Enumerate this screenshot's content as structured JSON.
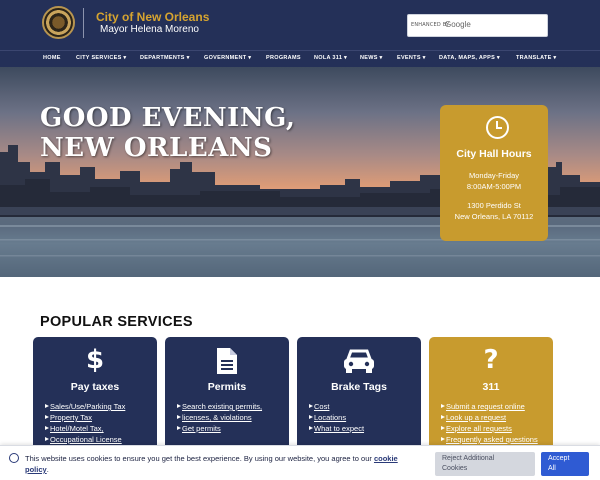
{
  "header": {
    "city_name": "City of New Orleans",
    "mayor_name": "Mayor Helena Moreno",
    "search": {
      "enhanced_label": "ENHANCED BY",
      "provider": "Google"
    }
  },
  "nav": {
    "items": [
      "HOME",
      "CITY SERVICES ▾",
      "DEPARTMENTS ▾",
      "GOVERNMENT ▾",
      "PROGRAMS",
      "NOLA 311 ▾",
      "NEWS ▾",
      "EVENTS ▾",
      "DATA, MAPS, APPS ▾",
      "TRANSLATE ▾"
    ]
  },
  "hero": {
    "greeting_line1": "GOOD EVENING,",
    "greeting_line2": "NEW ORLEANS",
    "hours": {
      "title": "City Hall Hours",
      "days": "Monday-Friday",
      "time": "8:00AM-5:00PM",
      "address1": "1300 Perdido St",
      "address2": "New Orleans, LA 70112"
    }
  },
  "services": {
    "title": "POPULAR SERVICES",
    "cards": [
      {
        "icon": "dollar-icon",
        "glyph": "$",
        "title": "Pay taxes",
        "links": [
          "Sales/Use/Parking Tax",
          "Property Tax",
          "Hotel/Motel Tax,",
          "Occupational License"
        ]
      },
      {
        "icon": "document-icon",
        "glyph": "",
        "title": "Permits",
        "links": [
          "Search existing permits,",
          "licenses, & violations",
          "Get permits"
        ]
      },
      {
        "icon": "car-icon",
        "glyph": "",
        "title": "Brake Tags",
        "links": [
          "Cost",
          "Locations",
          "What to expect"
        ]
      },
      {
        "icon": "question-icon",
        "glyph": "?",
        "title": "311",
        "links": [
          "Submit a request online",
          "Look up a request",
          "Explore all requests",
          "Frequently asked questions"
        ]
      }
    ]
  },
  "cookie": {
    "text": "This website uses cookies to ensure you get the best experience. By using our website, you agree to our",
    "link_word1": "cookie",
    "link_word2": "policy",
    "reject_line1": "Reject Additional",
    "reject_line2": "Cookies",
    "accept_line1": "Accept",
    "accept_line2": "All"
  },
  "colors": {
    "navy": "#243058",
    "gold": "#c89b2e",
    "accept_blue": "#2f5bd3"
  }
}
